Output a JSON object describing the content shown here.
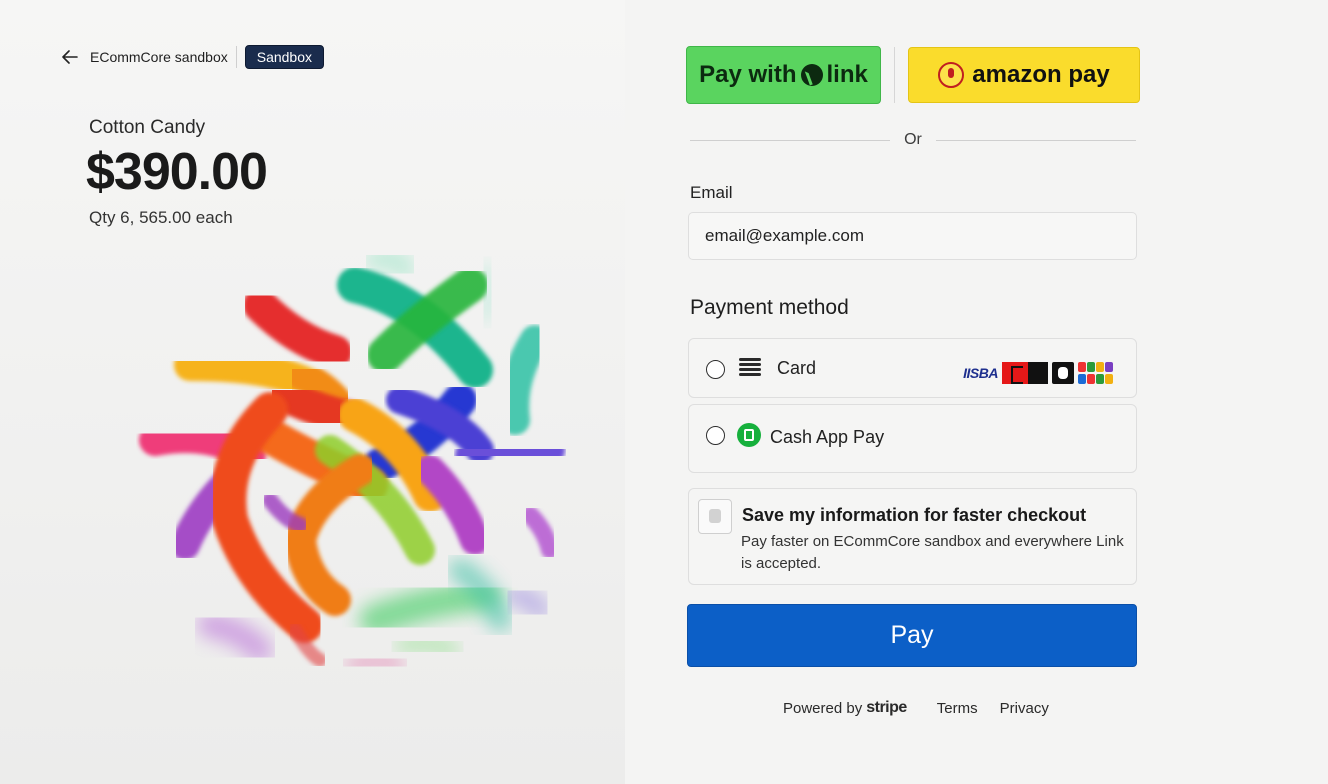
{
  "merchant": {
    "name": "ECommCore sandbox",
    "badge": "Sandbox"
  },
  "product": {
    "name": "Cotton Candy",
    "total": "$390.00",
    "qty_text": "Qty 6, 565.00 each"
  },
  "wallets": {
    "link_prefix": "Pay with",
    "link_brand": "link",
    "amazon_label": "amazon pay"
  },
  "divider_text": "Or",
  "email": {
    "label": "Email",
    "value": "email@example.com"
  },
  "payment": {
    "label": "Payment method",
    "options": [
      {
        "label": "Card",
        "icon": "card-icon"
      },
      {
        "label": "Cash App Pay",
        "icon": "cash-app-icon"
      }
    ],
    "card_brands": [
      "visa-logo",
      "mastercard-logo",
      "amex-logo",
      "discover-logo"
    ],
    "visa_text": "IISBA"
  },
  "save_info": {
    "title": "Save my information for faster checkout",
    "description": "Pay faster on ECommCore sandbox and everywhere Link is accepted."
  },
  "pay_button": "Pay",
  "footer": {
    "powered_by": "Powered by",
    "brand": "stripe",
    "terms": "Terms",
    "privacy": "Privacy"
  },
  "colors": {
    "link_green": "#5ad45f",
    "amazon_yellow": "#fadc2c",
    "pay_blue": "#0c5fc7",
    "badge_navy": "#1a2c4d"
  }
}
